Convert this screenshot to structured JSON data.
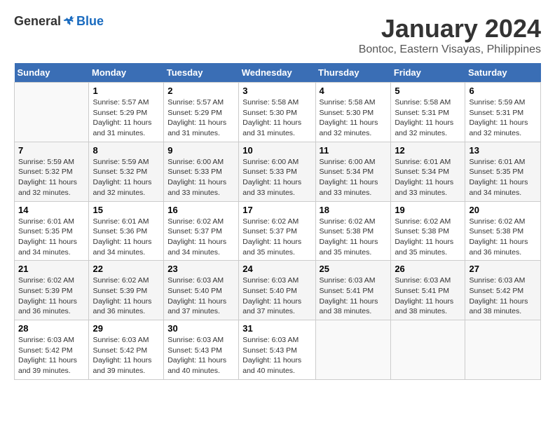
{
  "logo": {
    "general": "General",
    "blue": "Blue"
  },
  "title": "January 2024",
  "subtitle": "Bontoc, Eastern Visayas, Philippines",
  "days_of_week": [
    "Sunday",
    "Monday",
    "Tuesday",
    "Wednesday",
    "Thursday",
    "Friday",
    "Saturday"
  ],
  "weeks": [
    [
      {
        "num": "",
        "info": ""
      },
      {
        "num": "1",
        "info": "Sunrise: 5:57 AM\nSunset: 5:29 PM\nDaylight: 11 hours\nand 31 minutes."
      },
      {
        "num": "2",
        "info": "Sunrise: 5:57 AM\nSunset: 5:29 PM\nDaylight: 11 hours\nand 31 minutes."
      },
      {
        "num": "3",
        "info": "Sunrise: 5:58 AM\nSunset: 5:30 PM\nDaylight: 11 hours\nand 31 minutes."
      },
      {
        "num": "4",
        "info": "Sunrise: 5:58 AM\nSunset: 5:30 PM\nDaylight: 11 hours\nand 32 minutes."
      },
      {
        "num": "5",
        "info": "Sunrise: 5:58 AM\nSunset: 5:31 PM\nDaylight: 11 hours\nand 32 minutes."
      },
      {
        "num": "6",
        "info": "Sunrise: 5:59 AM\nSunset: 5:31 PM\nDaylight: 11 hours\nand 32 minutes."
      }
    ],
    [
      {
        "num": "7",
        "info": "Sunrise: 5:59 AM\nSunset: 5:32 PM\nDaylight: 11 hours\nand 32 minutes."
      },
      {
        "num": "8",
        "info": "Sunrise: 5:59 AM\nSunset: 5:32 PM\nDaylight: 11 hours\nand 32 minutes."
      },
      {
        "num": "9",
        "info": "Sunrise: 6:00 AM\nSunset: 5:33 PM\nDaylight: 11 hours\nand 33 minutes."
      },
      {
        "num": "10",
        "info": "Sunrise: 6:00 AM\nSunset: 5:33 PM\nDaylight: 11 hours\nand 33 minutes."
      },
      {
        "num": "11",
        "info": "Sunrise: 6:00 AM\nSunset: 5:34 PM\nDaylight: 11 hours\nand 33 minutes."
      },
      {
        "num": "12",
        "info": "Sunrise: 6:01 AM\nSunset: 5:34 PM\nDaylight: 11 hours\nand 33 minutes."
      },
      {
        "num": "13",
        "info": "Sunrise: 6:01 AM\nSunset: 5:35 PM\nDaylight: 11 hours\nand 34 minutes."
      }
    ],
    [
      {
        "num": "14",
        "info": "Sunrise: 6:01 AM\nSunset: 5:35 PM\nDaylight: 11 hours\nand 34 minutes."
      },
      {
        "num": "15",
        "info": "Sunrise: 6:01 AM\nSunset: 5:36 PM\nDaylight: 11 hours\nand 34 minutes."
      },
      {
        "num": "16",
        "info": "Sunrise: 6:02 AM\nSunset: 5:37 PM\nDaylight: 11 hours\nand 34 minutes."
      },
      {
        "num": "17",
        "info": "Sunrise: 6:02 AM\nSunset: 5:37 PM\nDaylight: 11 hours\nand 35 minutes."
      },
      {
        "num": "18",
        "info": "Sunrise: 6:02 AM\nSunset: 5:38 PM\nDaylight: 11 hours\nand 35 minutes."
      },
      {
        "num": "19",
        "info": "Sunrise: 6:02 AM\nSunset: 5:38 PM\nDaylight: 11 hours\nand 35 minutes."
      },
      {
        "num": "20",
        "info": "Sunrise: 6:02 AM\nSunset: 5:38 PM\nDaylight: 11 hours\nand 36 minutes."
      }
    ],
    [
      {
        "num": "21",
        "info": "Sunrise: 6:02 AM\nSunset: 5:39 PM\nDaylight: 11 hours\nand 36 minutes."
      },
      {
        "num": "22",
        "info": "Sunrise: 6:02 AM\nSunset: 5:39 PM\nDaylight: 11 hours\nand 36 minutes."
      },
      {
        "num": "23",
        "info": "Sunrise: 6:03 AM\nSunset: 5:40 PM\nDaylight: 11 hours\nand 37 minutes."
      },
      {
        "num": "24",
        "info": "Sunrise: 6:03 AM\nSunset: 5:40 PM\nDaylight: 11 hours\nand 37 minutes."
      },
      {
        "num": "25",
        "info": "Sunrise: 6:03 AM\nSunset: 5:41 PM\nDaylight: 11 hours\nand 38 minutes."
      },
      {
        "num": "26",
        "info": "Sunrise: 6:03 AM\nSunset: 5:41 PM\nDaylight: 11 hours\nand 38 minutes."
      },
      {
        "num": "27",
        "info": "Sunrise: 6:03 AM\nSunset: 5:42 PM\nDaylight: 11 hours\nand 38 minutes."
      }
    ],
    [
      {
        "num": "28",
        "info": "Sunrise: 6:03 AM\nSunset: 5:42 PM\nDaylight: 11 hours\nand 39 minutes."
      },
      {
        "num": "29",
        "info": "Sunrise: 6:03 AM\nSunset: 5:42 PM\nDaylight: 11 hours\nand 39 minutes."
      },
      {
        "num": "30",
        "info": "Sunrise: 6:03 AM\nSunset: 5:43 PM\nDaylight: 11 hours\nand 40 minutes."
      },
      {
        "num": "31",
        "info": "Sunrise: 6:03 AM\nSunset: 5:43 PM\nDaylight: 11 hours\nand 40 minutes."
      },
      {
        "num": "",
        "info": ""
      },
      {
        "num": "",
        "info": ""
      },
      {
        "num": "",
        "info": ""
      }
    ]
  ]
}
